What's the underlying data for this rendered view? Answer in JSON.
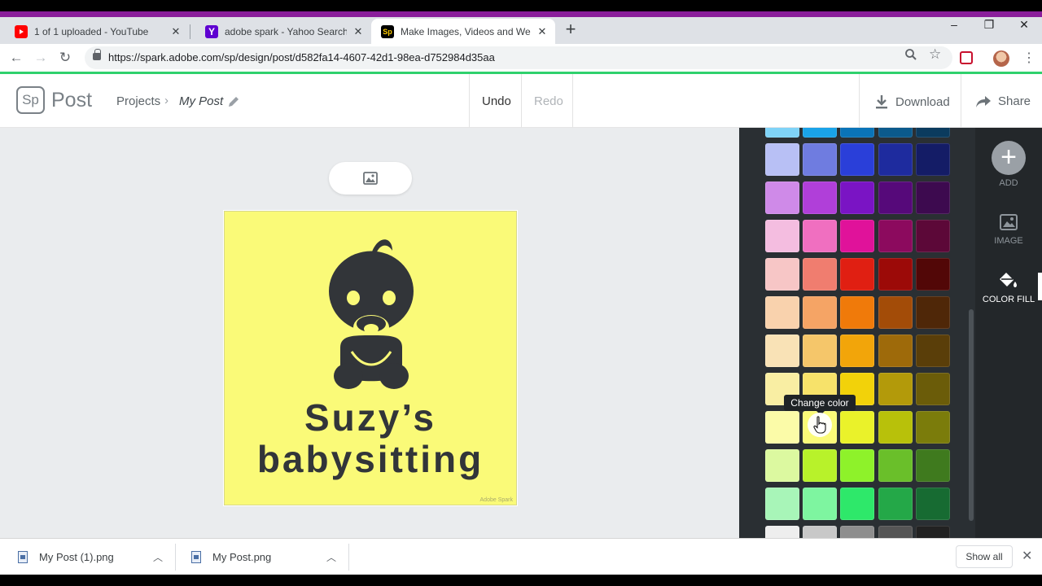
{
  "browser": {
    "tabs": [
      {
        "title": "1 of 1 uploaded - YouTube",
        "favicon": "youtube-icon",
        "color": "#ff0000"
      },
      {
        "title": "adobe spark - Yahoo Search Results",
        "favicon": "yahoo-icon",
        "color": "#5f01d1"
      },
      {
        "title": "Make Images, Videos and Web Stories",
        "favicon": "adobe-spark-icon",
        "color": "#000000",
        "active": true
      }
    ],
    "close_glyph": "✕",
    "new_tab_glyph": "+",
    "url": "https://spark.adobe.com/sp/design/post/d582fa14-4607-42d1-98ea-d752984d35aa"
  },
  "app": {
    "logo": "Sp",
    "product": "Post",
    "breadcrumb": {
      "projects": "Projects",
      "chevron": "›",
      "current": "My Post"
    },
    "undo": "Undo",
    "redo": "Redo",
    "download": "Download",
    "share": "Share"
  },
  "design": {
    "line1": "Suzy’s",
    "line2": "babysitting",
    "watermark": "Adobe Spark",
    "background": "#fafa78"
  },
  "palette": {
    "tooltip": "Change color",
    "rows": [
      [
        "#7fd3f7",
        "#1aa3e8",
        "#0a74b8",
        "#0b5a8c",
        "#0b3b5e"
      ],
      [
        "#b8c0f5",
        "#6f7ce0",
        "#2a3fd9",
        "#1e2b9e",
        "#141c66"
      ],
      [
        "#cf8ae8",
        "#b03fd9",
        "#7a14c4",
        "#56097a",
        "#3d0a4f"
      ],
      [
        "#f4bde0",
        "#f06fc0",
        "#e0129a",
        "#8c0a5e",
        "#5c0838"
      ],
      [
        "#f7c6c6",
        "#f07d6f",
        "#e01f12",
        "#9c0a08",
        "#520707"
      ],
      [
        "#f9d2ad",
        "#f5a465",
        "#f07a0a",
        "#a34c08",
        "#4f2708"
      ],
      [
        "#f9e2b6",
        "#f5c66a",
        "#f2a50a",
        "#9e6a0a",
        "#5a3e09"
      ],
      [
        "#f9eea3",
        "#f7e26a",
        "#f2d20a",
        "#b39a0a",
        "#6b5c09"
      ],
      [
        "#fbfba8",
        "#fafa78",
        "#eaf22a",
        "#b8c10a",
        "#7b7c0b"
      ],
      [
        "#dcf9a0",
        "#b8f22a",
        "#8ef22a",
        "#6abf2a",
        "#3f7a1e"
      ],
      [
        "#a8f5b8",
        "#7ef5a0",
        "#2ee86a",
        "#24a848",
        "#176b32"
      ],
      [
        "#eeeeee",
        "#c8c8c8",
        "#8e8e8e",
        "#555555",
        "#222222"
      ]
    ]
  },
  "rail": {
    "add": "ADD",
    "image": "IMAGE",
    "color_fill": "COLOR FILL"
  },
  "downloads": {
    "items": [
      "My Post (1).png",
      "My Post.png"
    ],
    "show_all": "Show all"
  }
}
